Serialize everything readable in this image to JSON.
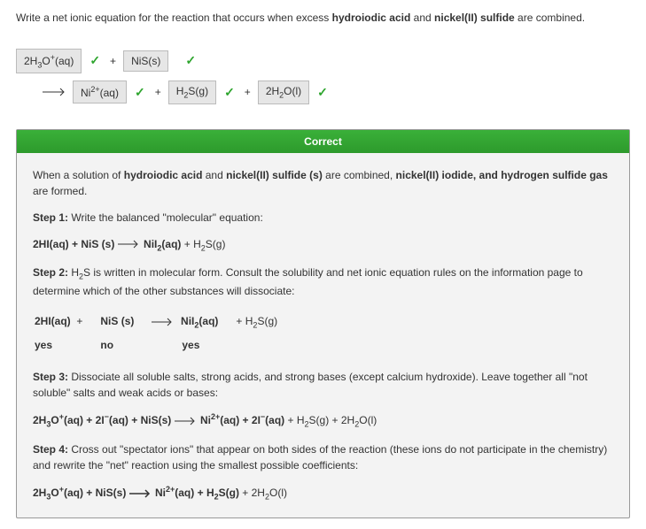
{
  "question": {
    "prefix": "Write a net ionic equation for the reaction that occurs when excess ",
    "bold1": "hydroiodic acid",
    "mid": " and ",
    "bold2": "nickel(II) sulfide",
    "suffix": " are combined."
  },
  "equation": {
    "box1": "2H₃O⁺(aq)",
    "plus": "+",
    "box2": "NiS(s)",
    "box3": "Ni²⁺(aq)",
    "box4": "H₂S(g)",
    "box5": "2H₂O(l)"
  },
  "feedback": {
    "header": "Correct",
    "intro_pre": "When a solution of ",
    "intro_b1": "hydroiodic acid",
    "intro_mid1": " and ",
    "intro_b2": "nickel(II) sulfide (s)",
    "intro_mid2": " are combined, ",
    "intro_b3": "nickel(II) iodide, and hydrogen sulfide gas",
    "intro_suf": " are formed.",
    "step1_label": "Step 1:",
    "step1_text": " Write the balanced \"molecular\" equation:",
    "step1_eq_l": "2HI(aq) + NiS (s)",
    "step1_eq_r": "NiI₂(aq) + H₂S(g)",
    "step2_label": "Step 2:",
    "step2_text": " H₂S is written in molecular form. Consult the solubility and net ionic equation rules on the information page to determine which of the other substances will dissociate:",
    "dissoc_c1": "2HI(aq)",
    "dissoc_c2": "NiS (s)",
    "dissoc_c3": "NiI₂(aq)",
    "dissoc_c4": "+ H₂S(g)",
    "dissoc_a1": "yes",
    "dissoc_a2": "no",
    "dissoc_a3": "yes",
    "step3_label": "Step 3:",
    "step3_text": " Dissociate all soluble salts, strong acids, and strong bases (except calcium hydroxide). Leave together all \"not soluble\" salts and weak acids or bases:",
    "step3_eq_l": "2H₃O⁺(aq) + 2I⁻(aq) + NiS(s)",
    "step3_eq_r": "Ni²⁺(aq) + 2I⁻(aq) + H₂S(g) + 2H₂O(l)",
    "step4_label": "Step 4:",
    "step4_text": " Cross out \"spectator ions\" that appear on both sides of the reaction (these ions do not participate in the chemistry) and rewrite the \"net\" reaction using the smallest possible coefficients:",
    "step4_eq_l": "2H₃O⁺(aq) + NiS(s)",
    "step4_eq_r": "Ni²⁺(aq) + H₂S(g) + 2H₂O(l)"
  }
}
